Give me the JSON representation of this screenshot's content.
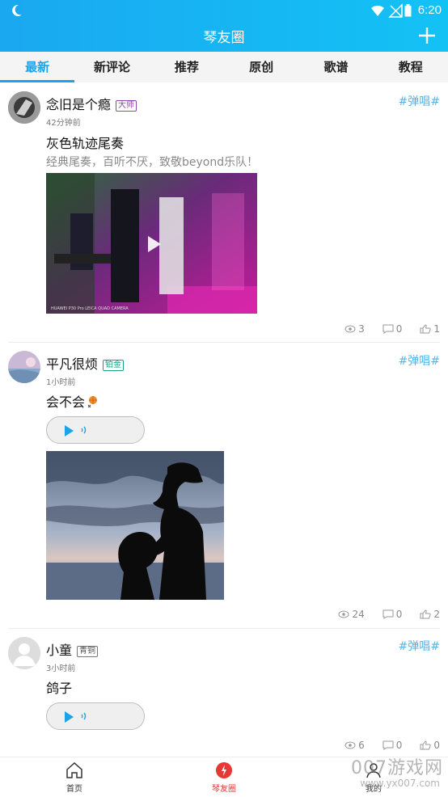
{
  "status_bar": {
    "time": "6:20"
  },
  "header": {
    "title": "琴友圈"
  },
  "tabs": [
    {
      "label": "最新",
      "active": true
    },
    {
      "label": "新评论",
      "active": false
    },
    {
      "label": "推荐",
      "active": false
    },
    {
      "label": "原创",
      "active": false
    },
    {
      "label": "歌谱",
      "active": false
    },
    {
      "label": "教程",
      "active": false
    }
  ],
  "posts": [
    {
      "username": "念旧是个瘾",
      "badge": "大师",
      "time": "42分钟前",
      "tag": "#弹唱#",
      "title": "灰色轨迹尾奏",
      "desc": "经典尾奏，百听不厌，致敬beyond乐队！",
      "media_caption": "HUAWEI P30 Pro LEICA QUAD CAMERA",
      "views": "3",
      "comments": "0",
      "likes": "1"
    },
    {
      "username": "平凡很烦",
      "badge": "铂金",
      "time": "1小时前",
      "tag": "#弹唱#",
      "title": "会不会",
      "views": "24",
      "comments": "0",
      "likes": "2"
    },
    {
      "username": "小童",
      "badge": "青铜",
      "time": "3小时前",
      "tag": "#弹唱#",
      "title": "鸽子",
      "views": "6",
      "comments": "0",
      "likes": "0"
    }
  ],
  "bottom_nav": [
    {
      "label": "首页"
    },
    {
      "label": "琴友圈"
    },
    {
      "label": "我的"
    }
  ],
  "watermark": {
    "text": "007游戏网",
    "url": "www.yx007.com"
  },
  "colors": {
    "header": "#1aa8f0",
    "accent": "#1aa3e8",
    "tag": "#58b4e6",
    "active_nav": "#e53935"
  }
}
